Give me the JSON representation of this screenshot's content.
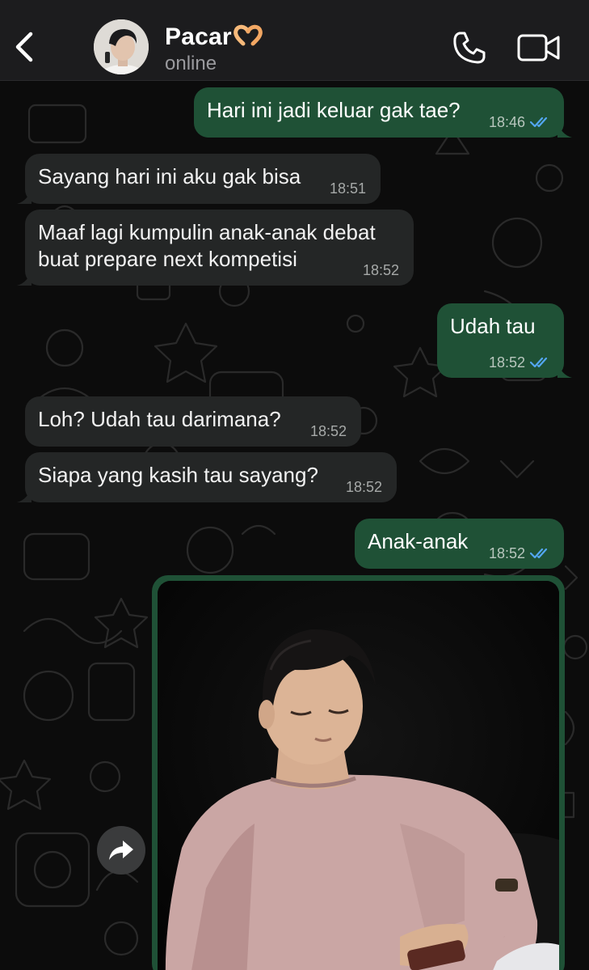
{
  "header": {
    "contact_name": "Pacar",
    "status": "online",
    "icons": {
      "back": "chevron-left-icon",
      "call": "phone-icon",
      "video": "video-camera-icon",
      "emoji": "heart-hands-emoji"
    }
  },
  "messages": [
    {
      "direction": "out",
      "text": "Hari ini jadi keluar gak tae?",
      "time": "18:46",
      "read": true
    },
    {
      "direction": "in",
      "text": "Sayang hari ini aku gak bisa",
      "time": "18:51"
    },
    {
      "direction": "in",
      "text": "Maaf lagi kumpulin anak-anak debat\nbuat prepare next kompetisi",
      "time": "18:52"
    },
    {
      "direction": "out",
      "text": "Udah tau",
      "time": "18:52",
      "read": true
    },
    {
      "direction": "in",
      "text": "Loh? Udah tau darimana?",
      "time": "18:52"
    },
    {
      "direction": "in",
      "text": "Siapa yang kasih tau sayang?",
      "time": "18:52"
    },
    {
      "direction": "out",
      "text": "Anak-anak",
      "time": "18:52",
      "read": true
    }
  ],
  "photo_message": {
    "direction": "out",
    "content": "photo of a man in a pink sweater looking down at a phone"
  },
  "colors": {
    "header_bg": "#1c1c1e",
    "incoming_bubble": "#242626",
    "outgoing_bubble": "#1f5136",
    "read_tick": "#53a6f0"
  }
}
